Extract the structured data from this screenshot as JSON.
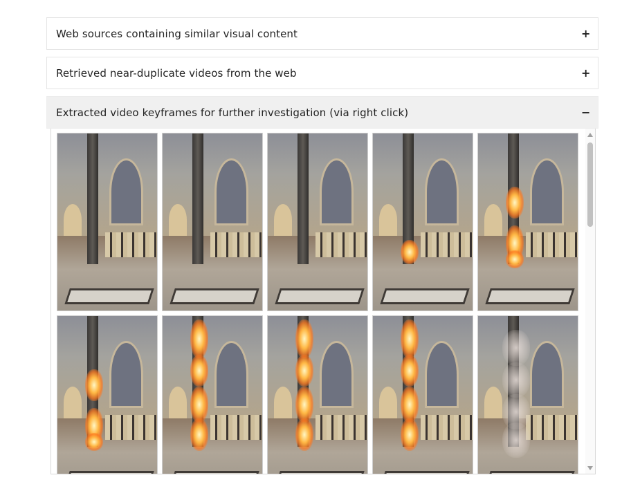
{
  "accordions": [
    {
      "title": "Web sources containing similar visual content",
      "toggle": "+"
    },
    {
      "title": "Retrieved near-duplicate videos from the web",
      "toggle": "+"
    },
    {
      "title": "Extracted video keyframes for further investigation (via right click)",
      "toggle": "−"
    }
  ],
  "keyframes": [
    {
      "fire": "none"
    },
    {
      "fire": "none"
    },
    {
      "fire": "none"
    },
    {
      "fire": "low"
    },
    {
      "fire": "mid"
    },
    {
      "fire": "mid"
    },
    {
      "fire": "high"
    },
    {
      "fire": "high"
    },
    {
      "fire": "high"
    },
    {
      "fire": "smoke"
    }
  ],
  "colors": {
    "accordion_open_bg": "#f0f0f0",
    "border": "#e4e4e4"
  }
}
